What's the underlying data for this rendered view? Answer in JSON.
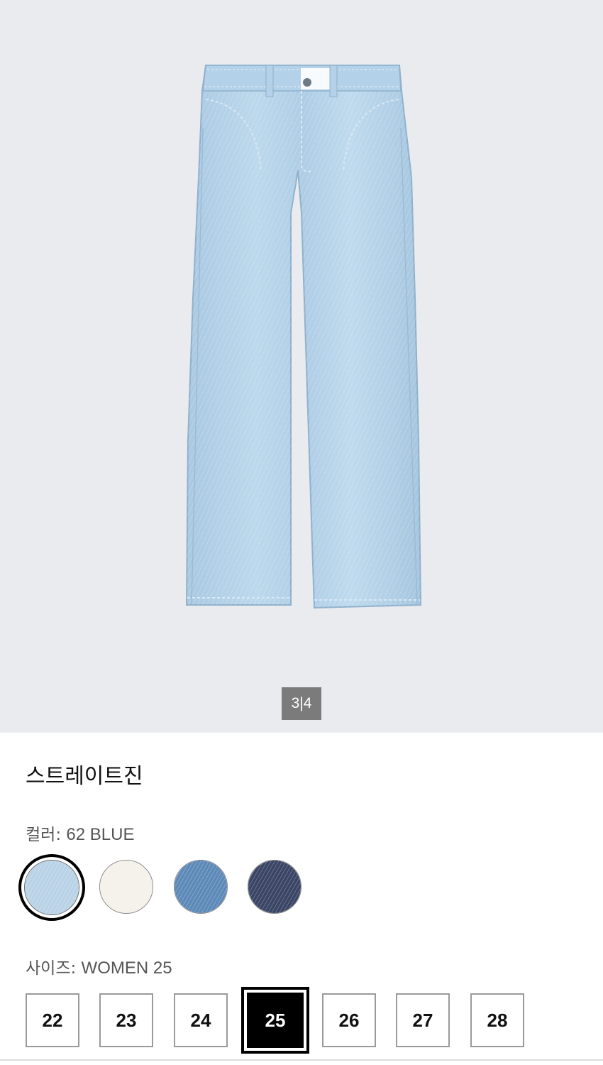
{
  "gallery": {
    "image_alt": "light blue straight jeans",
    "counter": "3|4",
    "background": "#e9ebee"
  },
  "product": {
    "title": "스트레이트진"
  },
  "color": {
    "label": "컬러:",
    "value": "62 BLUE",
    "swatches": [
      {
        "name": "62 BLUE",
        "color": "#b9d3e6",
        "selected": true
      },
      {
        "name": "off white",
        "color": "#f3f1ea",
        "selected": false
      },
      {
        "name": "blue",
        "color": "#5d89b8",
        "selected": false
      },
      {
        "name": "navy",
        "color": "#3a4565",
        "selected": false
      }
    ]
  },
  "size": {
    "label": "사이즈:",
    "value": "WOMEN 25",
    "options": [
      "22",
      "23",
      "24",
      "25",
      "26",
      "27",
      "28"
    ],
    "selected": "25"
  }
}
